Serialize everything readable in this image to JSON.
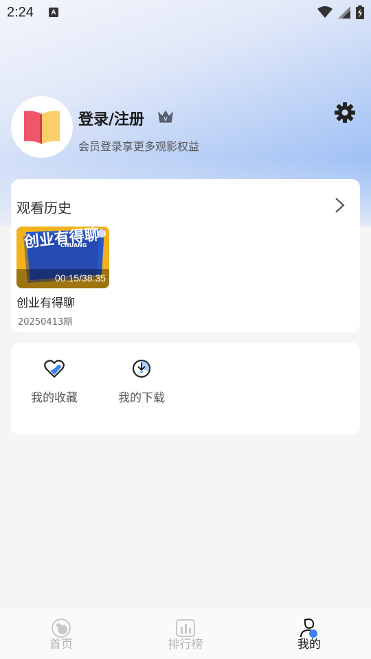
{
  "status_bar": {
    "time": "2:24",
    "notification_letter": "A"
  },
  "profile": {
    "login_label": "登录/注册",
    "subtitle": "会员登录享更多观影权益",
    "crown_letter": "V"
  },
  "history": {
    "title": "观看历史",
    "items": [
      {
        "thumbnail_text_main": "创业有得聊",
        "thumbnail_text_en": "CHUANG",
        "progress": "00:15/38:35",
        "title": "创业有得聊",
        "episode": "20250413期"
      }
    ]
  },
  "shortcuts": {
    "favorites_label": "我的收藏",
    "downloads_label": "我的下载"
  },
  "tabs": [
    {
      "label": "首页",
      "icon": "home-icon",
      "active": false
    },
    {
      "label": "排行榜",
      "icon": "chart-icon",
      "active": false
    },
    {
      "label": "我的",
      "icon": "profile-icon",
      "active": true
    }
  ],
  "colors": {
    "accent": "#3b82f6",
    "inactive_tab": "#b5b5b5",
    "active_tab": "#111111"
  }
}
